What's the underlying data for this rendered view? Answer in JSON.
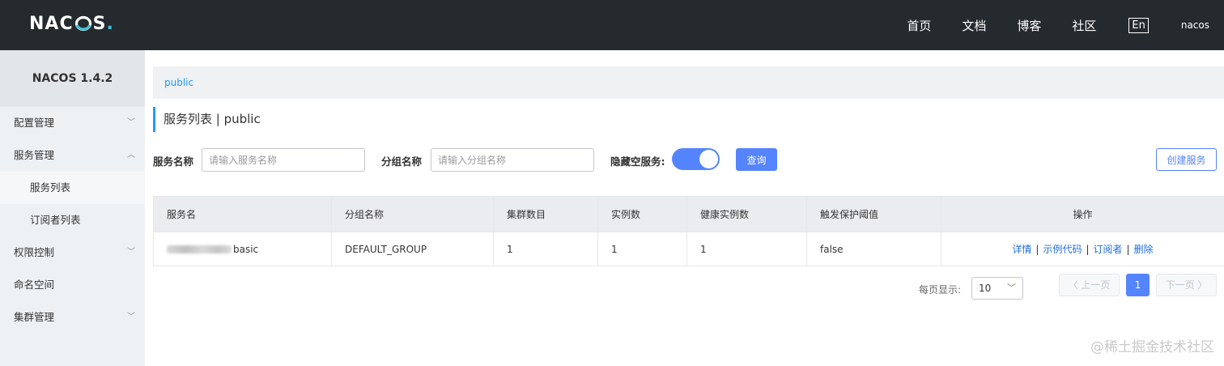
{
  "header": {
    "logo": {
      "part1": "NAC",
      "part2": "S",
      "dot": "."
    },
    "nav": [
      "首页",
      "文档",
      "博客",
      "社区"
    ],
    "lang_toggle": "En",
    "user": "nacos"
  },
  "sidebar": {
    "version": "NACOS 1.4.2",
    "items": [
      {
        "label": "配置管理",
        "chevron": "﹀"
      },
      {
        "label": "服务管理",
        "chevron": "︿"
      },
      {
        "label": "服务列表"
      },
      {
        "label": "订阅者列表"
      },
      {
        "label": "权限控制",
        "chevron": "﹀"
      },
      {
        "label": "命名空间"
      },
      {
        "label": "集群管理",
        "chevron": "﹀"
      }
    ]
  },
  "main": {
    "namespace": "public",
    "title": "服务列表  |  public",
    "filters": {
      "service_name_label": "服务名称",
      "service_name_placeholder": "请输入服务名称",
      "group_name_label": "分组名称",
      "group_name_placeholder": "请输入分组名称",
      "hide_empty_label": "隐藏空服务:",
      "hide_empty_on": true,
      "query_button": "查询",
      "create_button": "创建服务"
    },
    "table": {
      "columns": [
        "服务名",
        "分组名称",
        "集群数目",
        "实例数",
        "健康实例数",
        "触发保护阈值",
        "操作"
      ],
      "rows": [
        {
          "service_name_suffix": "basic",
          "group": "DEFAULT_GROUP",
          "clusters": "1",
          "instances": "1",
          "healthy": "1",
          "protect_threshold": "false",
          "actions": [
            "详情",
            "示例代码",
            "订阅者",
            "删除"
          ],
          "action_sep": "|"
        }
      ]
    },
    "pager": {
      "page_size_label": "每页显示:",
      "page_size": "10",
      "select_arrow": "﹀",
      "prev": "〈 上一页",
      "current": "1",
      "next": "下一页 〉"
    }
  },
  "watermark": "@稀土掘金技术社区",
  "colors": {
    "accent": "#5584ff",
    "topbar": "#252a2f",
    "link": "#1e6fd9",
    "ns": "#209bfa"
  }
}
